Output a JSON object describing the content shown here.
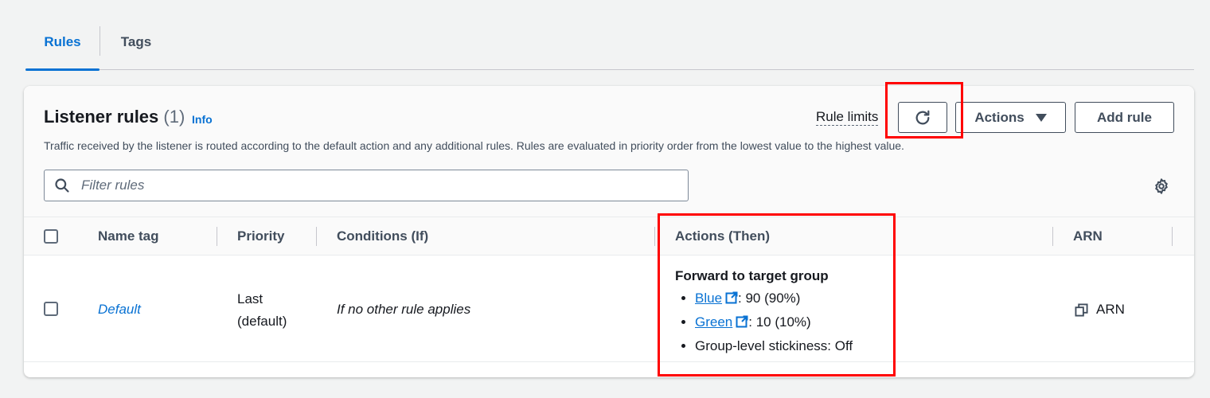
{
  "tabs": [
    {
      "label": "Rules",
      "active": true
    },
    {
      "label": "Tags",
      "active": false
    }
  ],
  "panel": {
    "title": "Listener rules",
    "count": "(1)",
    "info_label": "Info",
    "description": "Traffic received by the listener is routed according to the default action and any additional rules. Rules are evaluated in priority order from the lowest value to the highest value.",
    "rule_limits_label": "Rule limits",
    "actions_label": "Actions",
    "add_rule_label": "Add rule",
    "filter_placeholder": "Filter rules"
  },
  "table": {
    "columns": [
      "Name tag",
      "Priority",
      "Conditions (If)",
      "Actions (Then)",
      "ARN"
    ],
    "rows": [
      {
        "name": "Default",
        "priority_line1": "Last",
        "priority_line2": "(default)",
        "condition": "If no other rule applies",
        "action_title": "Forward to target group",
        "targets": [
          {
            "name": "Blue",
            "value": ": 90 (90%)"
          },
          {
            "name": "Green",
            "value": ": 10 (10%)"
          }
        ],
        "stickiness": "Group-level stickiness: Off",
        "arn_label": "ARN"
      }
    ]
  },
  "colors": {
    "accent": "#0972d3",
    "highlight": "#ff0000",
    "text": "#16191f",
    "muted": "#414d5c"
  },
  "icons": {
    "refresh": "refresh-icon",
    "search": "search-icon",
    "settings": "gear-icon",
    "external": "external-link-icon",
    "copy": "copy-icon",
    "caret": "caret-down-icon"
  }
}
